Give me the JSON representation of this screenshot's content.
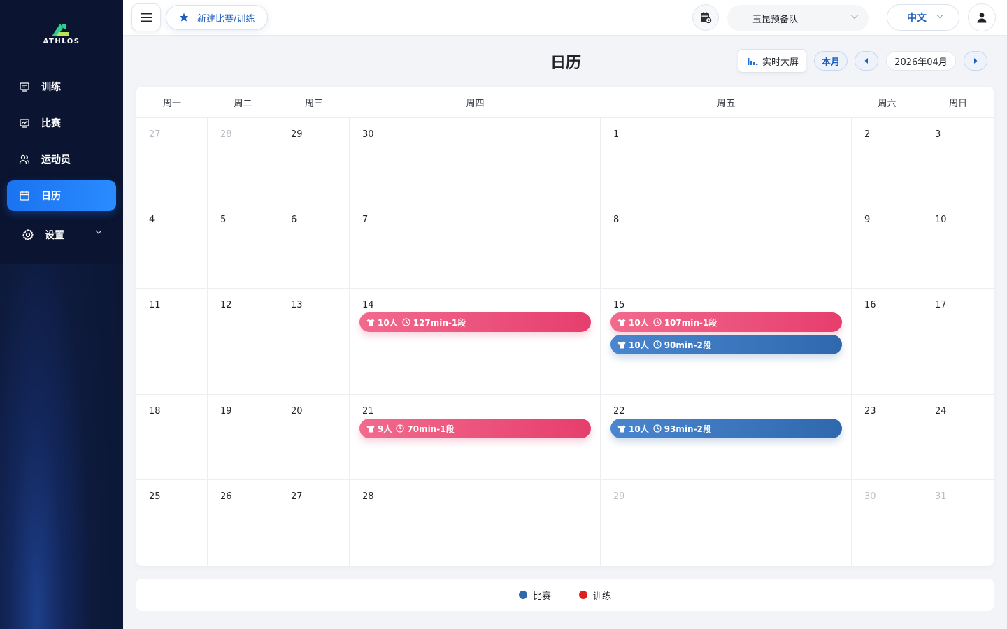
{
  "sidebar": {
    "logo_text": "ATHLOS",
    "items": [
      {
        "label": "训练",
        "icon": "training-icon"
      },
      {
        "label": "比赛",
        "icon": "match-icon"
      },
      {
        "label": "运动员",
        "icon": "athletes-icon"
      },
      {
        "label": "日历",
        "icon": "calendar-icon",
        "active": true
      },
      {
        "label": "设置",
        "icon": "settings-icon"
      }
    ]
  },
  "topbar": {
    "new_button": "新建比赛/训练",
    "team": "玉昆预备队",
    "language": "中文"
  },
  "header": {
    "title": "日历",
    "live_button": "实时大屏",
    "this_month": "本月",
    "month_label": "2026年04月"
  },
  "calendar": {
    "weekdays": [
      "周一",
      "周二",
      "周三",
      "周四",
      "周五",
      "周六",
      "周日"
    ],
    "weeks": [
      [
        {
          "d": "27",
          "m": true
        },
        {
          "d": "28",
          "m": true
        },
        {
          "d": "29"
        },
        {
          "d": "30"
        },
        {
          "d": "1"
        },
        {
          "d": "2"
        },
        {
          "d": "3"
        }
      ],
      [
        {
          "d": "4"
        },
        {
          "d": "5"
        },
        {
          "d": "6"
        },
        {
          "d": "7"
        },
        {
          "d": "8"
        },
        {
          "d": "9"
        },
        {
          "d": "10"
        }
      ],
      [
        {
          "d": "11"
        },
        {
          "d": "12"
        },
        {
          "d": "13"
        },
        {
          "d": "14"
        },
        {
          "d": "15"
        },
        {
          "d": "16"
        },
        {
          "d": "17"
        }
      ],
      [
        {
          "d": "18"
        },
        {
          "d": "19"
        },
        {
          "d": "20"
        },
        {
          "d": "21"
        },
        {
          "d": "22"
        },
        {
          "d": "23"
        },
        {
          "d": "24"
        }
      ],
      [
        {
          "d": "25"
        },
        {
          "d": "26"
        },
        {
          "d": "27"
        },
        {
          "d": "28"
        },
        {
          "d": "29",
          "m": true
        },
        {
          "d": "30",
          "m": true
        },
        {
          "d": "31",
          "m": true
        }
      ]
    ],
    "events": [
      {
        "week": 2,
        "day": 3,
        "type": "training",
        "people": "10人",
        "text": "127min-1段"
      },
      {
        "week": 2,
        "day": 4,
        "type": "training",
        "people": "10人",
        "text": "107min-1段"
      },
      {
        "week": 2,
        "day": 4,
        "type": "match",
        "people": "10人",
        "text": "90min-2段"
      },
      {
        "week": 3,
        "day": 3,
        "type": "training",
        "people": "9人",
        "text": "70min-1段"
      },
      {
        "week": 3,
        "day": 4,
        "type": "match",
        "people": "10人",
        "text": "93min-2段"
      }
    ]
  },
  "legend": [
    {
      "label": "比赛",
      "color": "#2f68ad"
    },
    {
      "label": "训练",
      "color": "#e0201b"
    }
  ]
}
